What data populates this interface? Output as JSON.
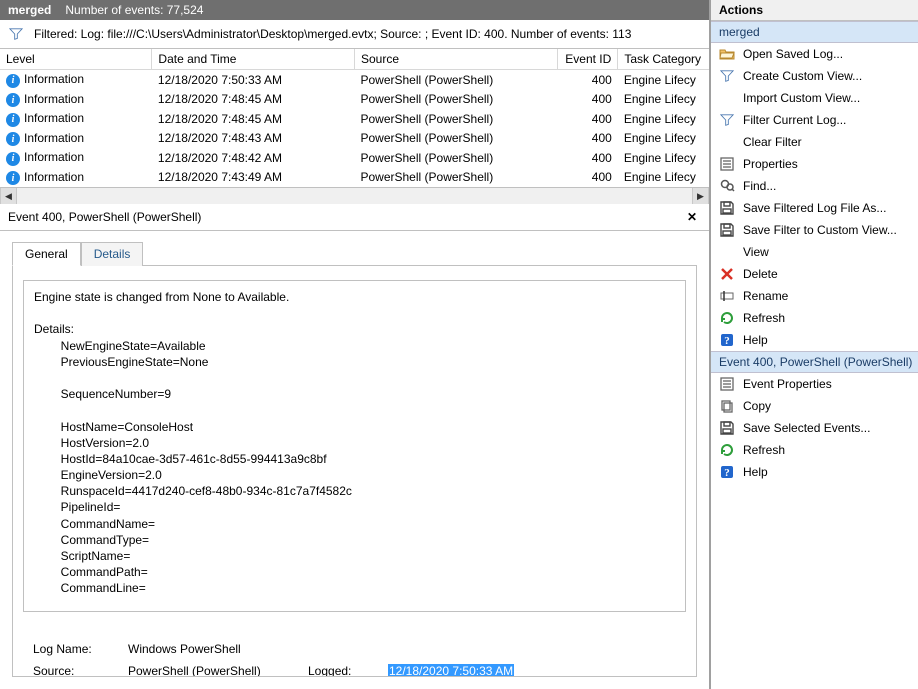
{
  "titlebar": {
    "title": "merged",
    "subtitle": "Number of events: 77,524"
  },
  "filterbar": {
    "text": "Filtered: Log: file:///C:\\Users\\Administrator\\Desktop\\merged.evtx; Source: ; Event ID: 400. Number of events: 113"
  },
  "columns": {
    "level": "Level",
    "datetime": "Date and Time",
    "source": "Source",
    "event_id": "Event ID",
    "task": "Task Category"
  },
  "rows": [
    {
      "level": "Information",
      "datetime": "12/18/2020 7:50:33 AM",
      "source": "PowerShell (PowerShell)",
      "event_id": "400",
      "task": "Engine Lifecy"
    },
    {
      "level": "Information",
      "datetime": "12/18/2020 7:48:45 AM",
      "source": "PowerShell (PowerShell)",
      "event_id": "400",
      "task": "Engine Lifecy"
    },
    {
      "level": "Information",
      "datetime": "12/18/2020 7:48:45 AM",
      "source": "PowerShell (PowerShell)",
      "event_id": "400",
      "task": "Engine Lifecy"
    },
    {
      "level": "Information",
      "datetime": "12/18/2020 7:48:43 AM",
      "source": "PowerShell (PowerShell)",
      "event_id": "400",
      "task": "Engine Lifecy"
    },
    {
      "level": "Information",
      "datetime": "12/18/2020 7:48:42 AM",
      "source": "PowerShell (PowerShell)",
      "event_id": "400",
      "task": "Engine Lifecy"
    },
    {
      "level": "Information",
      "datetime": "12/18/2020 7:43:49 AM",
      "source": "PowerShell (PowerShell)",
      "event_id": "400",
      "task": "Engine Lifecy"
    }
  ],
  "detail": {
    "header": "Event 400, PowerShell (PowerShell)",
    "tabs": {
      "general": "General",
      "details": "Details"
    },
    "body_text": "Engine state is changed from None to Available.\n\nDetails:\n        NewEngineState=Available\n        PreviousEngineState=None\n\n        SequenceNumber=9\n\n        HostName=ConsoleHost\n        HostVersion=2.0\n        HostId=84a10cae-3d57-461c-8d55-994413a9c8bf\n        EngineVersion=2.0\n        RunspaceId=4417d240-cef8-48b0-934c-81c7a7f4582c\n        PipelineId=\n        CommandName=\n        CommandType=\n        ScriptName=\n        CommandPath=\n        CommandLine=",
    "meta": {
      "log_name_label": "Log Name:",
      "log_name_value": "Windows PowerShell",
      "source_label": "Source:",
      "source_value": "PowerShell (PowerShell)",
      "logged_label": "Logged:",
      "logged_value": "12/18/2020 7:50:33 AM"
    }
  },
  "actions": {
    "title": "Actions",
    "group1": {
      "header": "merged",
      "items": [
        {
          "icon": "folder-open-icon",
          "label": "Open Saved Log..."
        },
        {
          "icon": "funnel-plus-icon",
          "label": "Create Custom View..."
        },
        {
          "icon": "blank-icon",
          "label": "Import Custom View..."
        },
        {
          "icon": "funnel-icon",
          "label": "Filter Current Log..."
        },
        {
          "icon": "blank-icon",
          "label": "Clear Filter"
        },
        {
          "icon": "properties-icon",
          "label": "Properties"
        },
        {
          "icon": "find-icon",
          "label": "Find..."
        },
        {
          "icon": "save-icon",
          "label": "Save Filtered Log File As..."
        },
        {
          "icon": "save-icon",
          "label": "Save Filter to Custom View..."
        },
        {
          "icon": "blank-icon",
          "label": "View"
        },
        {
          "icon": "delete-icon",
          "label": "Delete"
        },
        {
          "icon": "rename-icon",
          "label": "Rename"
        },
        {
          "icon": "refresh-icon",
          "label": "Refresh"
        },
        {
          "icon": "help-icon",
          "label": "Help"
        }
      ]
    },
    "group2": {
      "header": "Event 400, PowerShell (PowerShell)",
      "items": [
        {
          "icon": "properties-icon",
          "label": "Event Properties"
        },
        {
          "icon": "copy-icon",
          "label": "Copy"
        },
        {
          "icon": "save-icon",
          "label": "Save Selected Events..."
        },
        {
          "icon": "refresh-icon",
          "label": "Refresh"
        },
        {
          "icon": "help-icon",
          "label": "Help"
        }
      ]
    }
  }
}
